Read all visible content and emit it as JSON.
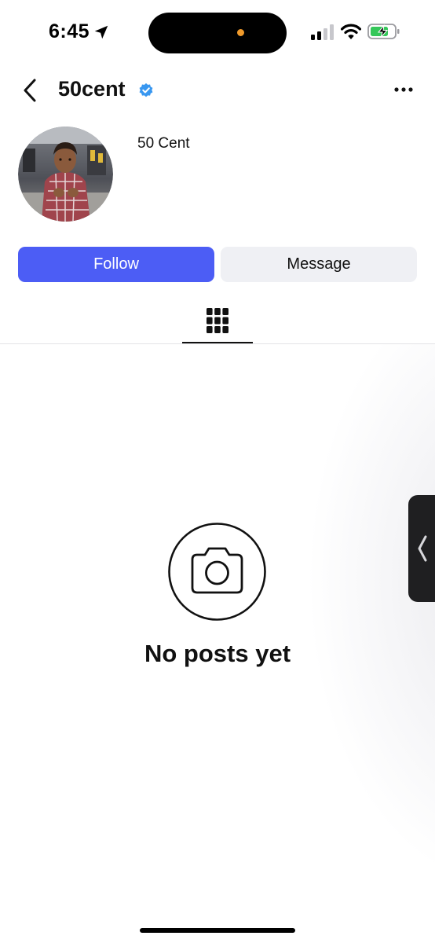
{
  "status_bar": {
    "time": "6:45",
    "location_icon": "location-arrow-icon",
    "signal_icon": "cellular-signal-icon",
    "wifi_icon": "wifi-icon",
    "battery_icon": "battery-charging-icon",
    "island_dot_color": "#f09a2b",
    "battery_color": "#34c759"
  },
  "header": {
    "back_icon": "chevron-left-icon",
    "username": "50cent",
    "verified_icon": "verified-badge-icon",
    "verified_color": "#3897f0",
    "more_icon": "more-horizontal-icon"
  },
  "profile": {
    "display_name": "50 Cent",
    "avatar_icon": "profile-photo"
  },
  "actions": {
    "follow_label": "Follow",
    "message_label": "Message",
    "follow_color": "#4c5df5"
  },
  "tabs": {
    "grid_icon": "grid-icon"
  },
  "empty_state": {
    "icon": "camera-icon",
    "text": "No posts yet"
  }
}
